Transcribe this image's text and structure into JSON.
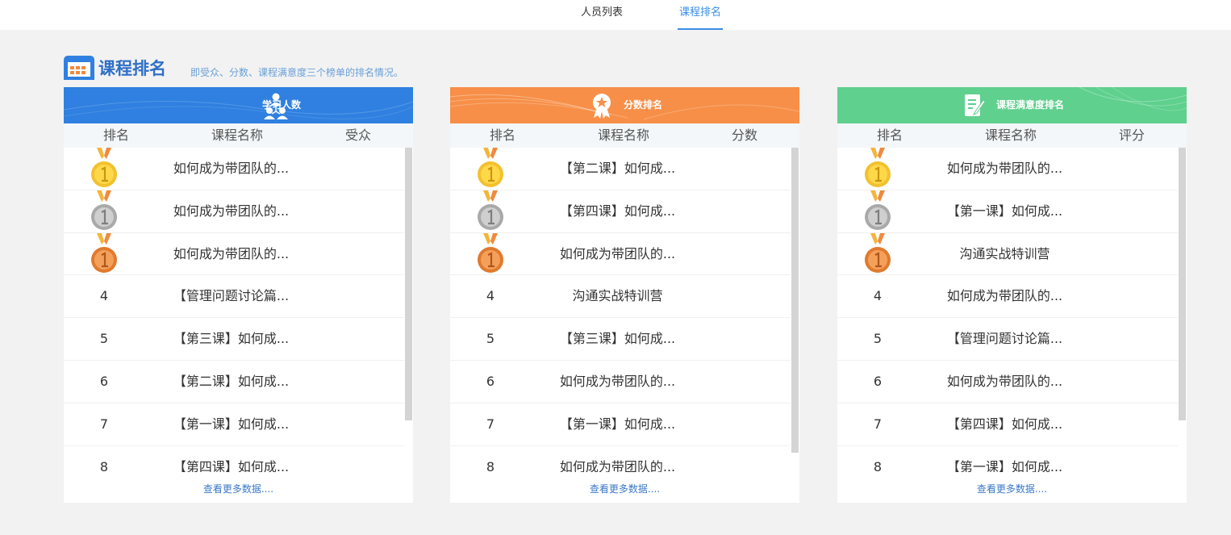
{
  "tabs": [
    {
      "label": "人员列表",
      "active": false
    },
    {
      "label": "课程排名",
      "active": true
    }
  ],
  "section": {
    "icon": "calendar-grid-icon",
    "title": "课程排名",
    "subtitle": "即受众、分数、课程满意度三个榜单的排名情况。"
  },
  "colors": {
    "blue": "#2f80e0",
    "orange": "#f78f48",
    "green": "#5fd08e",
    "link": "#3a78c8",
    "tab_active": "#3a8ee6"
  },
  "panels": [
    {
      "title": "学习人数",
      "icon": "users-icon",
      "columns": [
        "排名",
        "课程名称",
        "受众"
      ],
      "rows": [
        {
          "rank": "1",
          "name": "如何成为带团队的..."
        },
        {
          "rank": "2",
          "name": "如何成为带团队的..."
        },
        {
          "rank": "3",
          "name": "如何成为带团队的..."
        },
        {
          "rank": "4",
          "name": "【管理问题讨论篇..."
        },
        {
          "rank": "5",
          "name": "【第三课】如何成..."
        },
        {
          "rank": "6",
          "name": "【第二课】如何成..."
        },
        {
          "rank": "7",
          "name": "【第一课】如何成..."
        },
        {
          "rank": "8",
          "name": "【第四课】如何成..."
        }
      ],
      "more": "查看更多数据....",
      "scroll_fraction": 0.84
    },
    {
      "title": "分数排名",
      "icon": "award-ribbon-icon",
      "columns": [
        "排名",
        "课程名称",
        "分数"
      ],
      "rows": [
        {
          "rank": "1",
          "name": "【第二课】如何成..."
        },
        {
          "rank": "2",
          "name": "【第四课】如何成..."
        },
        {
          "rank": "3",
          "name": "如何成为带团队的..."
        },
        {
          "rank": "4",
          "name": "沟通实战特训营"
        },
        {
          "rank": "5",
          "name": "【第三课】如何成..."
        },
        {
          "rank": "6",
          "name": "如何成为带团队的..."
        },
        {
          "rank": "7",
          "name": "【第一课】如何成..."
        },
        {
          "rank": "8",
          "name": "如何成为带团队的..."
        }
      ],
      "more": "查看更多数据....",
      "scroll_fraction": 0.94
    },
    {
      "title": "课程满意度排名",
      "icon": "edit-document-icon",
      "columns": [
        "排名",
        "课程名称",
        "评分"
      ],
      "rows": [
        {
          "rank": "1",
          "name": "如何成为带团队的..."
        },
        {
          "rank": "2",
          "name": "【第一课】如何成..."
        },
        {
          "rank": "3",
          "name": "沟通实战特训营"
        },
        {
          "rank": "4",
          "name": "如何成为带团队的..."
        },
        {
          "rank": "5",
          "name": "【管理问题讨论篇..."
        },
        {
          "rank": "6",
          "name": "如何成为带团队的..."
        },
        {
          "rank": "7",
          "name": "【第四课】如何成..."
        },
        {
          "rank": "8",
          "name": "【第一课】如何成..."
        }
      ],
      "more": "查看更多数据....",
      "scroll_fraction": 0.84
    }
  ]
}
